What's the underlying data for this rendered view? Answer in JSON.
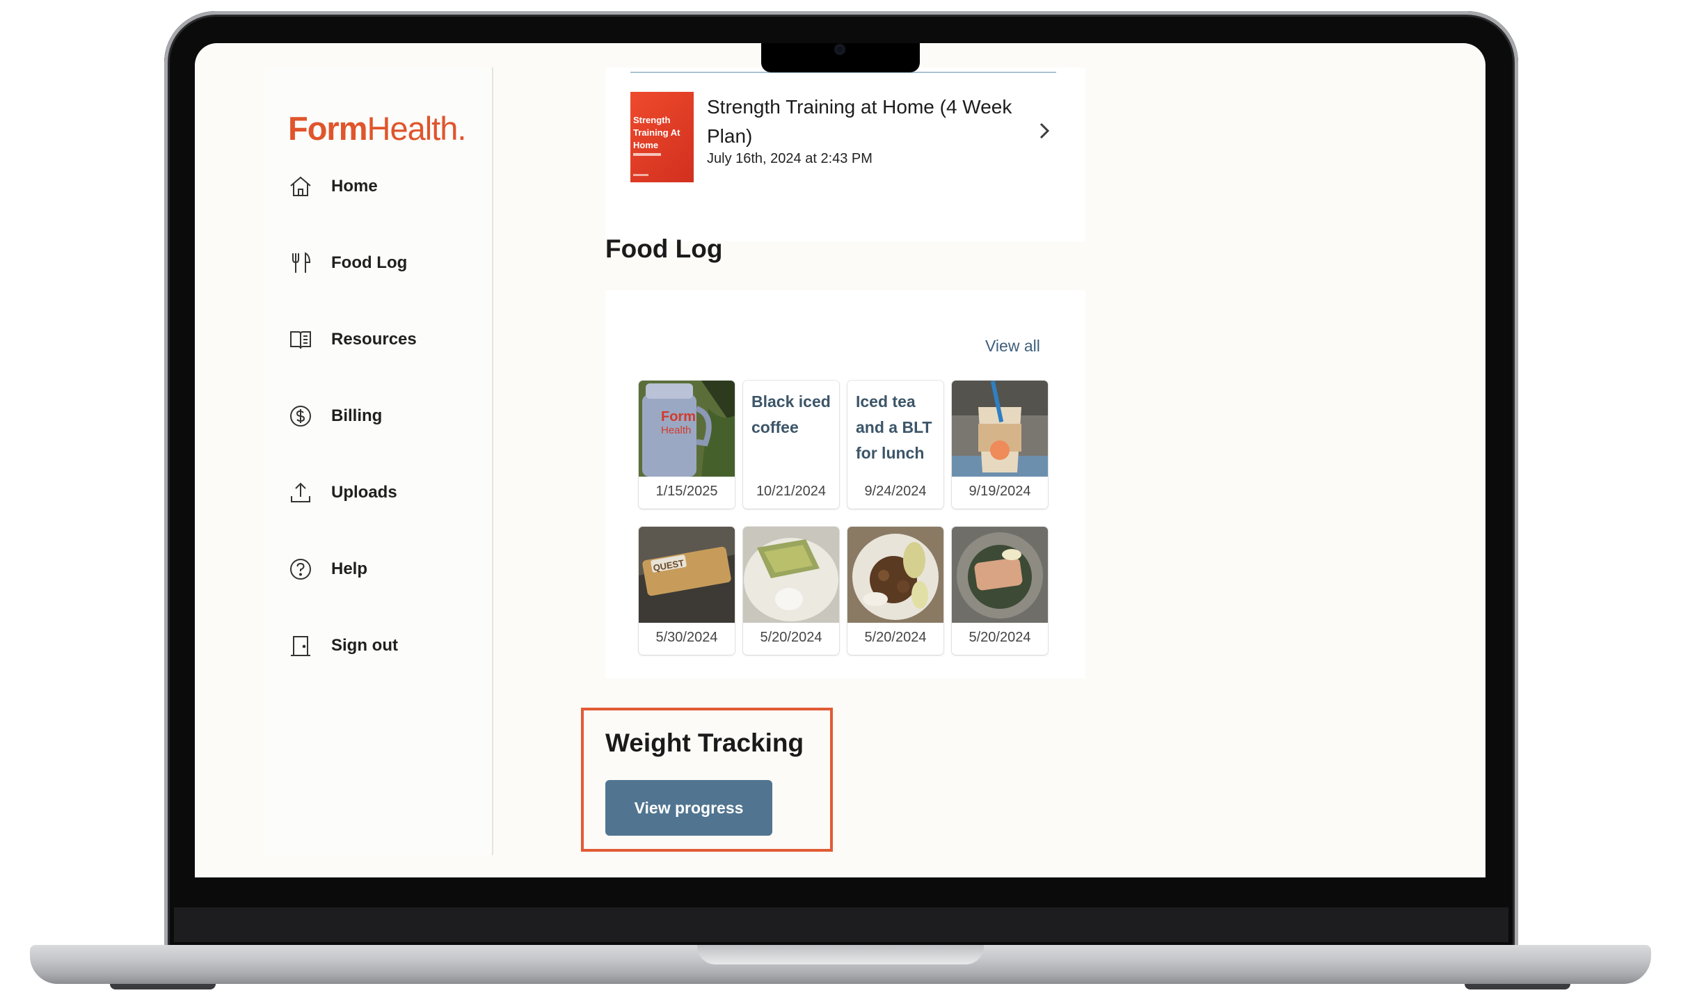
{
  "brand": {
    "logo_bold": "Form",
    "logo_regular": "Health",
    "logo_dot": "."
  },
  "sidebar": {
    "items": [
      {
        "label": "Home",
        "icon": "home-icon"
      },
      {
        "label": "Food Log",
        "icon": "utensils-icon"
      },
      {
        "label": "Resources",
        "icon": "book-icon"
      },
      {
        "label": "Billing",
        "icon": "dollar-circle-icon"
      },
      {
        "label": "Uploads",
        "icon": "upload-icon"
      },
      {
        "label": "Help",
        "icon": "help-circle-icon"
      },
      {
        "label": "Sign out",
        "icon": "door-icon"
      }
    ]
  },
  "plan": {
    "title": "Strength Training at Home (4 Week Plan)",
    "date": "July 16th, 2024 at 2:43 PM",
    "thumb_text": "Strength Training At Home"
  },
  "food_log": {
    "title": "Food Log",
    "view_all": "View all",
    "entries": [
      {
        "type": "photo",
        "date": "1/15/2025",
        "subject": "Form Health tumbler"
      },
      {
        "type": "text",
        "text": "Black iced coffee",
        "date": "10/21/2024"
      },
      {
        "type": "text",
        "text": "Iced tea and a BLT for lunch",
        "date": "9/24/2024"
      },
      {
        "type": "photo",
        "date": "9/19/2024",
        "subject": "smoothie cup"
      },
      {
        "type": "photo",
        "date": "5/30/2024",
        "subject": "Quest protein bar"
      },
      {
        "type": "photo",
        "date": "5/20/2024",
        "subject": "avocado toast"
      },
      {
        "type": "photo",
        "date": "5/20/2024",
        "subject": "granola with fruit"
      },
      {
        "type": "photo",
        "date": "5/20/2024",
        "subject": "salmon plate"
      }
    ]
  },
  "weight_tracking": {
    "title": "Weight Tracking",
    "button": "View progress"
  },
  "colors": {
    "brand": "#e0552c",
    "button": "#517590",
    "highlight": "#e15b34",
    "link": "#3f5f7c"
  }
}
